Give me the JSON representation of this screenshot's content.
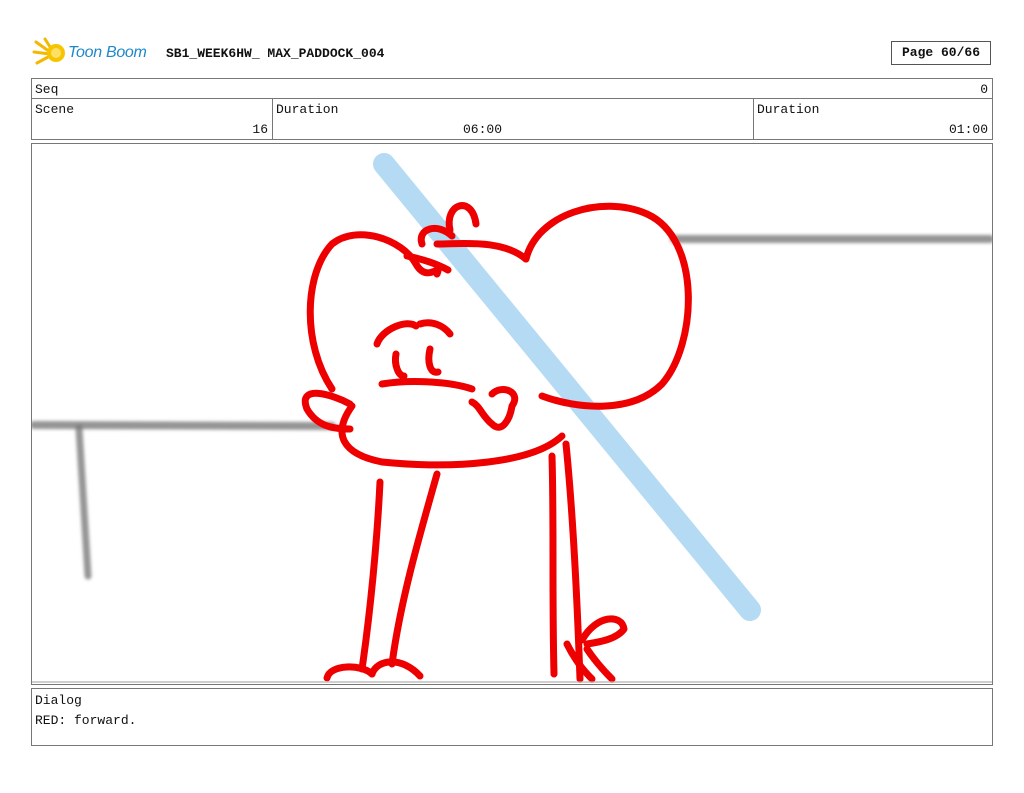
{
  "header": {
    "logo_text": "Toon Boom",
    "title": "SB1_WEEK6HW_ MAX_PADDOCK_004",
    "page": "Page 60/66"
  },
  "seq": {
    "label": "Seq",
    "value": "0"
  },
  "scene": {
    "label": "Scene",
    "value": "16",
    "duration1_label": "Duration",
    "duration1_value": "06:00",
    "duration2_label": "Duration",
    "duration2_value": "01:00"
  },
  "panel": {
    "icon": "storyboard-drawing",
    "colors": {
      "character": "#ee0000",
      "prop": "#a9d4f2",
      "background": "#808080"
    }
  },
  "dialog": {
    "label": "Dialog",
    "text": "RED: forward."
  }
}
